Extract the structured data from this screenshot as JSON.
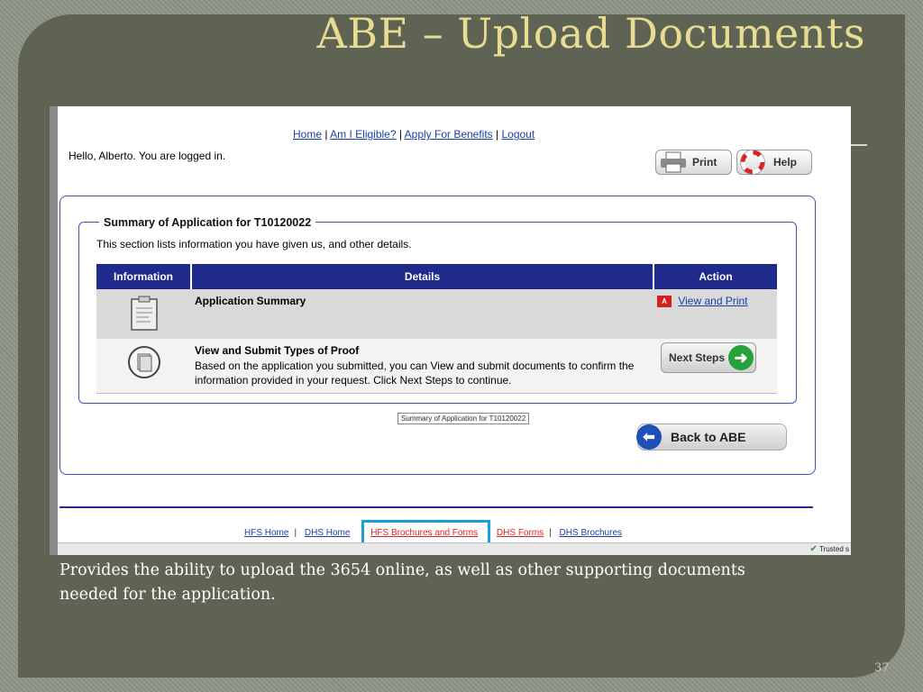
{
  "slide": {
    "title": "ABE – Upload Documents",
    "caption": "Provides the ability to upload the 3654 online, as well as other supporting documents needed for the application.",
    "page_number": "37"
  },
  "app": {
    "nav": [
      "Home",
      "Am I Eligible?",
      "Apply For Benefits",
      "Logout"
    ],
    "greeting": "Hello, Alberto. You are logged in.",
    "print_label": "Print",
    "help_label": "Help",
    "section_title": "Summary of Application for T10120022",
    "section_intro": "This section lists information you have given us, and other details.",
    "table": {
      "headers": [
        "Information",
        "Details",
        "Action"
      ],
      "rows": [
        {
          "title": "Application Summary",
          "body": "",
          "action": "View and Print"
        },
        {
          "title": "View and Submit Types of Proof",
          "body": "Based on the application you submitted, you can View and submit documents to confirm the information provided in your request. Click Next Steps to continue.",
          "action": "Next Steps"
        }
      ]
    },
    "tooltip": "Summary of Application for T10120022",
    "back_label": "Back to ABE",
    "footer": [
      "HFS Home",
      "DHS Home",
      "HFS Brochures and Forms",
      "DHS Forms",
      "DHS Brochures"
    ],
    "status_text": "Trusted s"
  },
  "colors": {
    "title": "#e7dc92",
    "panel": "#5e6354",
    "table_header": "#1f2a8c",
    "highlight": "#1aa0d8",
    "link": "#1b3fa8"
  }
}
